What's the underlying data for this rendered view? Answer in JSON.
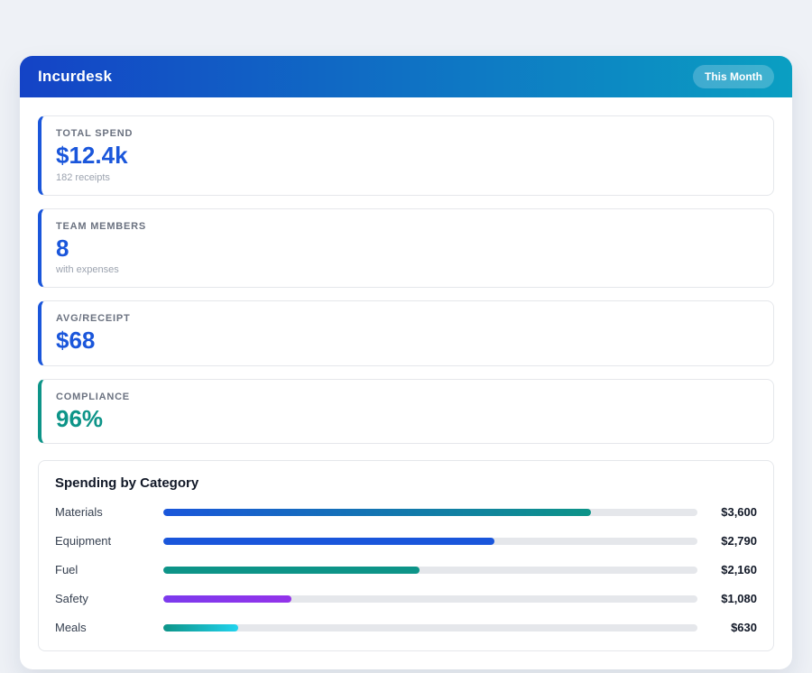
{
  "app": {
    "title": "Incurdesk",
    "month_badge": "This Month"
  },
  "theme": {
    "header_gradient_start": "#1443c6",
    "header_gradient_end": "#0a9fc2",
    "accent_blue": "#1a56db",
    "accent_teal": "#0d9488"
  },
  "stats": [
    {
      "label": "TOTAL SPEND",
      "value": "$12.4k",
      "sub": "182 receipts",
      "accent": "#1a56db",
      "value_color": "#1a56db"
    },
    {
      "label": "TEAM MEMBERS",
      "value": "8",
      "sub": "with expenses",
      "accent": "#1a56db",
      "value_color": "#1a56db"
    },
    {
      "label": "AVG/RECEIPT",
      "value": "$68",
      "sub": "",
      "accent": "#1a56db",
      "value_color": "#1a56db"
    },
    {
      "label": "COMPLIANCE",
      "value": "96%",
      "sub": "",
      "accent": "#0d9488",
      "value_color": "#0d9488"
    }
  ],
  "spending_section": {
    "title": "Spending by Category"
  },
  "chart_data": {
    "type": "bar",
    "orientation": "horizontal",
    "title": "Spending by Category",
    "categories": [
      "Materials",
      "Equipment",
      "Fuel",
      "Safety",
      "Meals"
    ],
    "values": [
      3600,
      2790,
      2160,
      1080,
      630
    ],
    "value_labels": [
      "$3,600",
      "$2,790",
      "$2,160",
      "$1,080",
      "$630"
    ],
    "axis_max": 4500,
    "grid": false,
    "legend": false,
    "bar_colors": [
      [
        "#1a56db",
        "#0d9488"
      ],
      [
        "#1a56db",
        "#1a56db"
      ],
      [
        "#0d9488",
        "#0d9488"
      ],
      [
        "#7c3aed",
        "#9333ea"
      ],
      [
        "#0d9488",
        "#22d3ee"
      ]
    ]
  }
}
